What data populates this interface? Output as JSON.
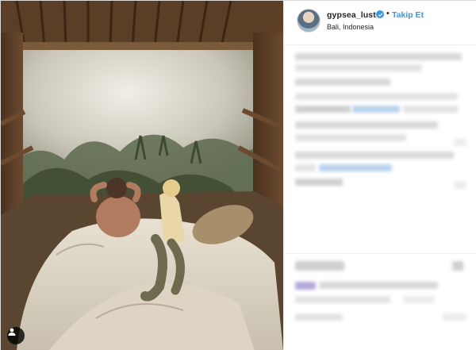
{
  "post": {
    "username": "gypsea_lust",
    "follow_label": "Takip Et",
    "separator": "•",
    "location": "Bali, Indonesia"
  },
  "icons": {
    "verified": "verified-badge-icon",
    "user_tag": "person-tag-icon"
  },
  "colors": {
    "accent": "#3897f0",
    "text": "#262626",
    "border": "#dbdbdb"
  }
}
